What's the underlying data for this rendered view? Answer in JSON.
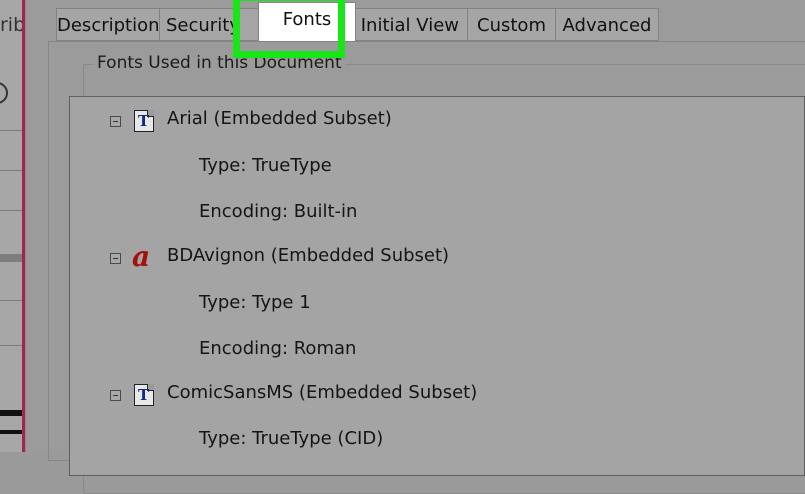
{
  "background_window": {
    "title_fragment": "rib"
  },
  "tabs": [
    {
      "label": "Description"
    },
    {
      "label": "Security"
    },
    {
      "label": "Fonts",
      "active": true
    },
    {
      "label": "Initial View"
    },
    {
      "label": "Custom"
    },
    {
      "label": "Advanced"
    }
  ],
  "fonts_group": {
    "title": "Fonts Used in this Document",
    "fonts": [
      {
        "name": "Arial (Embedded Subset)",
        "icon": "truetype-font-icon",
        "type": "Type: TrueType",
        "encoding": "Encoding: Built-in"
      },
      {
        "name": "BDAvignon (Embedded Subset)",
        "icon": "type1-font-icon",
        "type": "Type: Type 1",
        "encoding": "Encoding: Roman"
      },
      {
        "name": "ComicSansMS (Embedded Subset)",
        "icon": "truetype-font-icon",
        "type": "Type: TrueType (CID)"
      }
    ]
  },
  "colors": {
    "highlight": "#19e619",
    "accent": "#a0264c",
    "type1_icon": "#a40f0f",
    "truetype_icon": "#0a2a8c"
  }
}
